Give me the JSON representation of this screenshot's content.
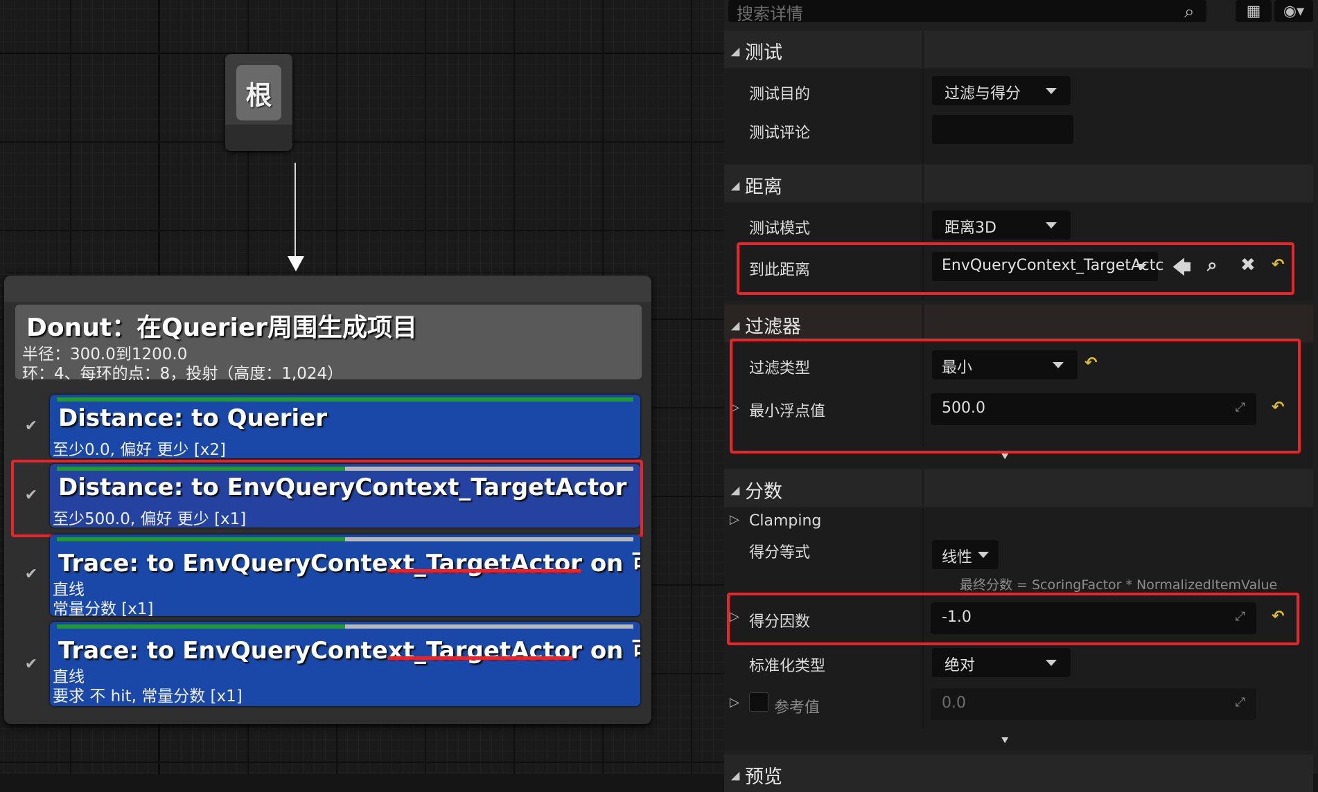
{
  "graph": {
    "root_label": "根",
    "generator": {
      "title": "Donut：在Querier周围生成项目",
      "line1": "半径：300.0到1200.0",
      "line2": "环：4、每环的点：8，投射（高度：1,024）"
    },
    "tests": [
      {
        "title": "Distance: to Querier",
        "lines": [
          "至少0.0, 偏好 更少 [x2]"
        ],
        "score_fill": 1.0
      },
      {
        "title": "Distance: to EnvQueryContext_TargetActor",
        "lines": [
          "至少500.0, 偏好 更少 [x1]"
        ],
        "score_fill": 0.5
      },
      {
        "title": "Trace: to EnvQueryContext_TargetActor on 可视性",
        "lines": [
          "直线",
          "常量分数 [x1]"
        ],
        "score_fill": 0.5
      },
      {
        "title": "Trace: to EnvQueryContext_TargetActor on 可视性",
        "lines": [
          "直线",
          "要求 不 hit, 常量分数 [x1]"
        ],
        "score_fill": 0.5
      }
    ]
  },
  "details": {
    "search_placeholder": "搜索详情",
    "categories": {
      "test": "测试",
      "distance": "距离",
      "filter": "过滤器",
      "score": "分数",
      "preview": "预览"
    },
    "props": {
      "test_purpose": {
        "label": "测试目的",
        "value": "过滤与得分"
      },
      "test_comment": {
        "label": "测试评论",
        "value": ""
      },
      "test_mode": {
        "label": "测试模式",
        "value": "距离3D"
      },
      "distance_to": {
        "label": "到此距离",
        "value": "EnvQueryContext_TargetActc"
      },
      "filter_type": {
        "label": "过滤类型",
        "value": "最小"
      },
      "float_min": {
        "label": "最小浮点值",
        "value": "500.0"
      },
      "clamping": {
        "label": "Clamping"
      },
      "scoring_equation": {
        "label": "得分等式",
        "value": "线性"
      },
      "formula": "最终分数 = ScoringFactor * NormalizedItemValue",
      "scoring_factor": {
        "label": "得分因数",
        "value": "-1.0"
      },
      "normalization_type": {
        "label": "标准化类型",
        "value": "绝对"
      },
      "reference_value": {
        "label": "参考值",
        "value": "0.0"
      }
    }
  },
  "colors": {
    "highlight": "#e8262a",
    "test_blue": "#1a48a8",
    "score_green": "#1f9a2c",
    "reset_yellow": "#e0c020"
  }
}
